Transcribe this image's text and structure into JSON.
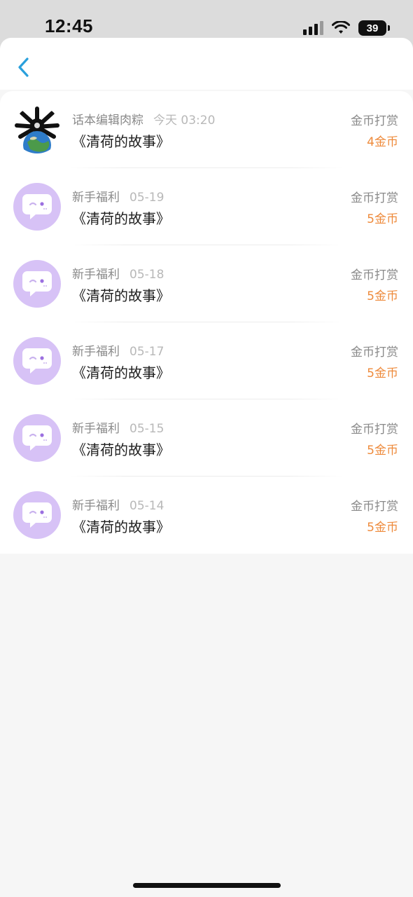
{
  "status_bar": {
    "time": "12:45",
    "battery": "39"
  },
  "nav": {
    "back_icon": "chevron-left-icon",
    "accent_color": "#2aa0dc"
  },
  "colors": {
    "amount": "#ee8a3b",
    "avatar_bg": "#d7c2f6"
  },
  "records": [
    {
      "sender": "话本编辑肉粽",
      "date": "今天 03:20",
      "title": "《清荷的故事》",
      "reward_type": "金币打赏",
      "amount": "4金币",
      "avatar": "custom-artwork"
    },
    {
      "sender": "新手福利",
      "date": "05-19",
      "title": "《清荷的故事》",
      "reward_type": "金币打赏",
      "amount": "5金币",
      "avatar": "chat-bubble-icon"
    },
    {
      "sender": "新手福利",
      "date": "05-18",
      "title": "《清荷的故事》",
      "reward_type": "金币打赏",
      "amount": "5金币",
      "avatar": "chat-bubble-icon"
    },
    {
      "sender": "新手福利",
      "date": "05-17",
      "title": "《清荷的故事》",
      "reward_type": "金币打赏",
      "amount": "5金币",
      "avatar": "chat-bubble-icon"
    },
    {
      "sender": "新手福利",
      "date": "05-15",
      "title": "《清荷的故事》",
      "reward_type": "金币打赏",
      "amount": "5金币",
      "avatar": "chat-bubble-icon"
    },
    {
      "sender": "新手福利",
      "date": "05-14",
      "title": "《清荷的故事》",
      "reward_type": "金币打赏",
      "amount": "5金币",
      "avatar": "chat-bubble-icon"
    }
  ]
}
